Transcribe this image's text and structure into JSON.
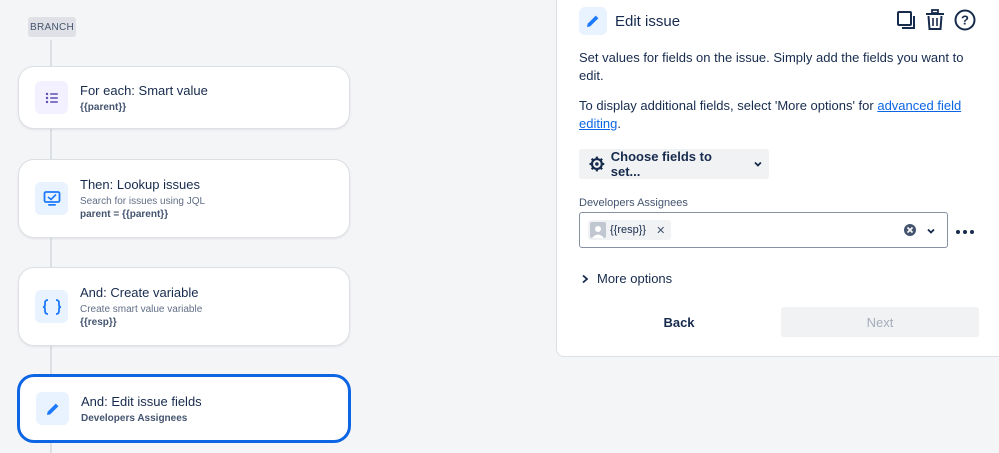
{
  "canvas": {
    "branch_label": "BRANCH",
    "cards": [
      {
        "title": "For each: Smart value",
        "subtitle": "",
        "detail": "{{parent}}",
        "icon": "list-icon"
      },
      {
        "title": "Then: Lookup issues",
        "subtitle": "Search for issues using JQL",
        "detail": "parent = {{parent}}",
        "icon": "lookup-screen-icon"
      },
      {
        "title": "And: Create variable",
        "subtitle": "Create smart value variable",
        "detail": "{{resp}}",
        "icon": "braces-icon"
      },
      {
        "title": "And: Edit issue fields",
        "subtitle": "",
        "detail": "Developers Assignees",
        "icon": "pencil-icon"
      }
    ]
  },
  "panel": {
    "title": "Edit issue",
    "desc1": "Set values for fields on the issue. Simply add the fields you want to edit.",
    "desc2_prefix": "To display additional fields, select 'More options' for ",
    "desc2_link": "advanced field editing",
    "desc2_suffix": ".",
    "choose_label": "Choose fields to set...",
    "field_label": "Developers Assignees",
    "field_chip": "{{resp}}",
    "more_options": "More options",
    "back_label": "Back",
    "next_label": "Next"
  },
  "colors": {
    "accent": "#0c66e4",
    "icon_purple": "#5e4db2",
    "icon_blue": "#1d7afc"
  }
}
